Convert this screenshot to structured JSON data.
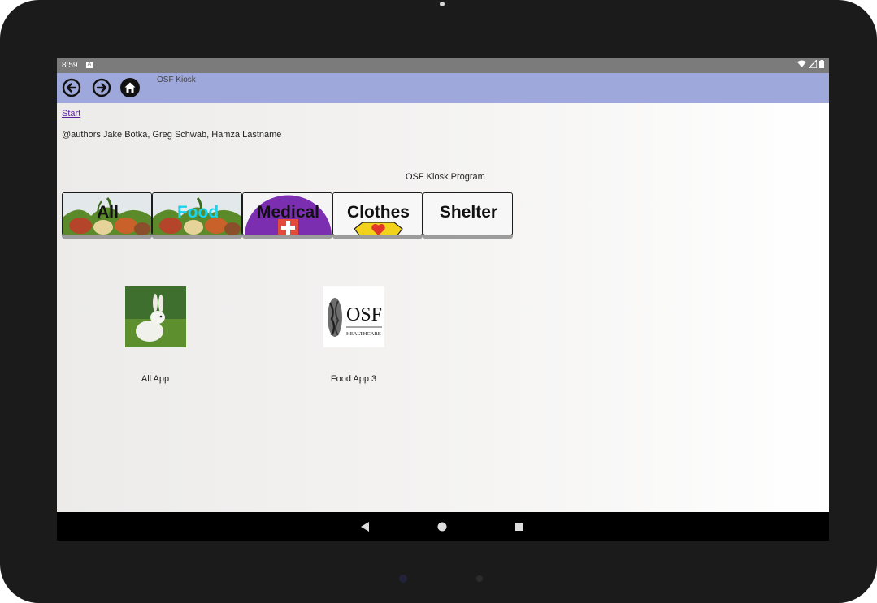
{
  "status_bar": {
    "time": "8:59",
    "notification_icon": "a-notification-icon",
    "right_icons": [
      "wifi-icon",
      "signal-icon",
      "battery-icon"
    ]
  },
  "app_bar": {
    "title": "OSF Kiosk",
    "back_icon": "arrow-left-circle-icon",
    "forward_icon": "arrow-right-circle-icon",
    "home_icon": "home-icon",
    "color": "#9fa8da"
  },
  "page": {
    "start_link": "Start",
    "authors": "@authors Jake Botka, Greg Schwab, Hamza Lastname",
    "program_title": "OSF Kiosk Program"
  },
  "categories": [
    {
      "label": "All",
      "label_color": "#111111",
      "background": "vegetables-image"
    },
    {
      "label": "Food",
      "label_color": "#19d4ee",
      "background": "vegetables-image"
    },
    {
      "label": "Medical",
      "label_color": "#111111",
      "background": "medical-cross-image",
      "accent": "#7b2fb0"
    },
    {
      "label": "Clothes",
      "label_color": "#111111",
      "background": "heart-shirt-image",
      "accent": "#f2d21b"
    },
    {
      "label": "Shelter",
      "label_color": "#111111",
      "background": "none"
    }
  ],
  "apps": [
    {
      "label": "All App",
      "icon": "rabbit-image"
    },
    {
      "label": "Food App 3",
      "icon": "osf-healthcare-logo",
      "logo_text": "OSF",
      "logo_subtext": "HEALTHCARE"
    }
  ],
  "system_nav": {
    "back": "back-triangle-icon",
    "home": "home-circle-icon",
    "recents": "recents-square-icon"
  }
}
